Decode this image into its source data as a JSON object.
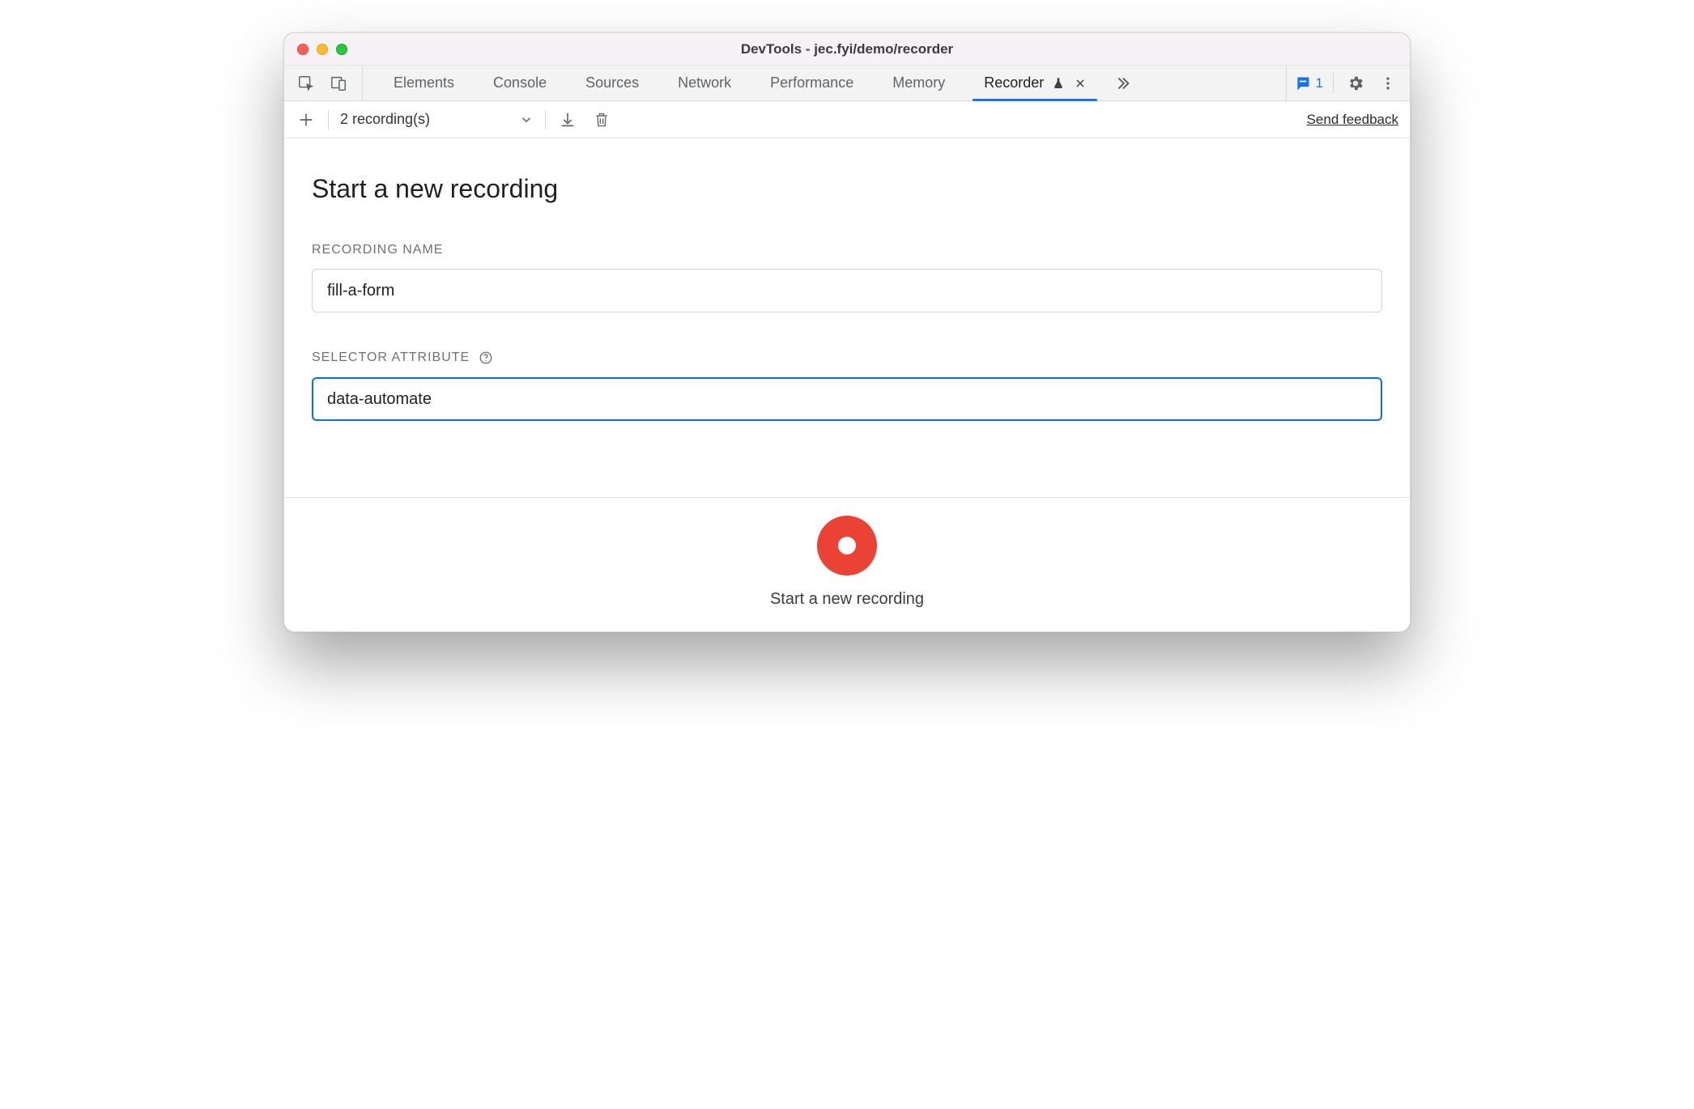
{
  "window": {
    "title": "DevTools - jec.fyi/demo/recorder"
  },
  "tabs": {
    "items": [
      "Elements",
      "Console",
      "Sources",
      "Network",
      "Performance",
      "Memory"
    ],
    "active": {
      "label": "Recorder"
    },
    "issues_count": "1"
  },
  "toolbar": {
    "selector_label": "2 recording(s)",
    "feedback": "Send feedback"
  },
  "main": {
    "heading": "Start a new recording",
    "recording_name_label": "Recording Name",
    "recording_name_value": "fill-a-form",
    "selector_attr_label": "Selector Attribute",
    "selector_attr_value": "data-automate"
  },
  "footer": {
    "record_label": "Start a new recording"
  }
}
